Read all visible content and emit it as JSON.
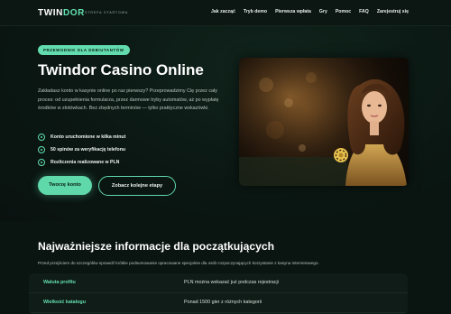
{
  "header": {
    "logo_main": "TWIN",
    "logo_accent": "DOR",
    "tagline": "STREFA STARTOWA",
    "nav": [
      "Jak zacząć",
      "Tryb demo",
      "Pierwsza wpłata",
      "Gry",
      "Pomoc",
      "FAQ",
      "Zarejestruj się"
    ]
  },
  "hero": {
    "badge": "PRZEWODNIK DLA DEBIUTANTÓW",
    "title": "Twindor Casino Online",
    "intro": "Zakładasz konto w kasynie online po raz pierwszy? Przeprowadzimy Cię przez cały proces: od uzupełnienia formularza, przez darmowe tryby automatów, aż po wypłatę środków w złotówkach. Bez zbędnych terminów — tylko praktyczne wskazówki.",
    "features": [
      "Konto uruchomione w kilka minut",
      "50 spinów za weryfikację telefonu",
      "Rozliczenia realizowane w PLN"
    ],
    "primary_button": "Tworzę konto",
    "secondary_button": "Zobacz kolejne etapy",
    "accent_color": "#5fd8aa"
  },
  "info": {
    "title": "Najważniejsze informacje dla początkujących",
    "description": "Przed przejściem do szczegółów sprawdź krótkie podsumowanie opracowane specjalnie dla osób rozpoczynających korzystanie z kasyna internetowego.",
    "rows": [
      {
        "label": "Waluta profilu",
        "value": "PLN można wskazać już podczas rejestracji"
      },
      {
        "label": "Wielkość katalogu",
        "value": "Ponad 1500 gier z różnych kategorii"
      }
    ]
  }
}
